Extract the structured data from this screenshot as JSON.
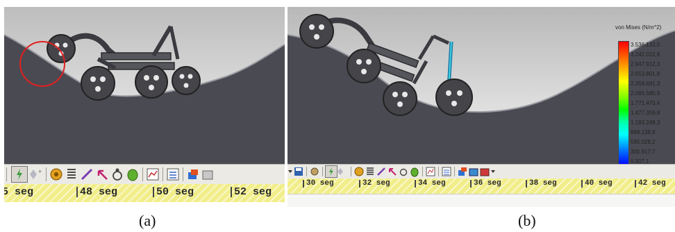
{
  "panel_a": {
    "timeline": {
      "ticks": [
        "5 seg",
        "48 seg",
        "50 seg",
        "52 seg"
      ]
    },
    "caption": "(a)"
  },
  "panel_b": {
    "legend": {
      "title": "von Mises (N/m^2)",
      "values": [
        "3.536.133,5",
        "3.242.022,8",
        "2.947.912,3",
        "2.653.801,8",
        "2.359.691,3",
        "2.065.580,9",
        "1.771.470,4",
        "1.477.359,8",
        "1.183.249,3",
        "889.138,8",
        "595.028,2",
        "300.917,7",
        "6.807,1"
      ]
    },
    "timeline": {
      "ticks": [
        "30 seg",
        "32 seg",
        "34 seg",
        "36 seg",
        "38 seg",
        "40 seg",
        "42 seg"
      ]
    },
    "caption": "(b)"
  },
  "colors": {
    "terrain": "#4a4a52",
    "sky_top": "#bdbdbd",
    "sky_bottom": "#f2f2f2",
    "timeline": "#f1ee8a",
    "highlight_circle": "#e02020"
  }
}
